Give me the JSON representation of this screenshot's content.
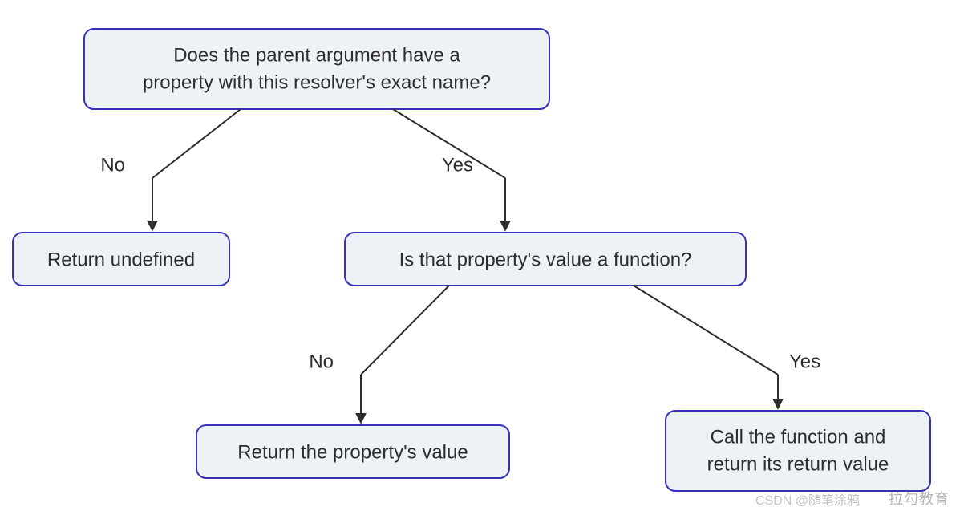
{
  "nodes": {
    "root": {
      "line1": "Does the parent argument have a",
      "line2": "property with this resolver's exact name?"
    },
    "return_undefined": {
      "line1": "Return undefined"
    },
    "is_function": {
      "line1": "Is that property's value a function?"
    },
    "return_value": {
      "line1": "Return the property's value"
    },
    "call_function": {
      "line1": "Call the function and",
      "line2": "return its return value"
    }
  },
  "edges": {
    "root_no": "No",
    "root_yes": "Yes",
    "fn_no": "No",
    "fn_yes": "Yes"
  },
  "watermark_primary": "拉勾教育",
  "watermark_secondary": "CSDN @随笔涂鸦"
}
